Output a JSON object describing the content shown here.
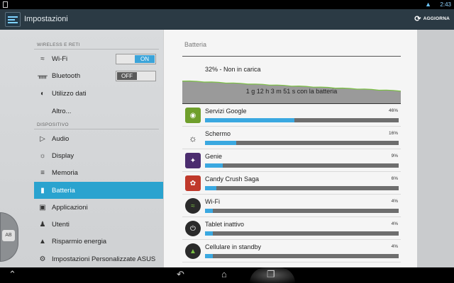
{
  "status_bar": {
    "time": "2:43",
    "wifi_icon": "wifi-icon"
  },
  "action_bar": {
    "title": "Impostazioni",
    "refresh_label": "AGGIORNA"
  },
  "sidebar": {
    "sections": [
      {
        "header": "WIRELESS E RETI"
      },
      {
        "header": "DISPOSITIVO"
      }
    ],
    "items": [
      {
        "label": "Wi-Fi",
        "icon": "wifi-icon",
        "toggle": "ON"
      },
      {
        "label": "Bluetooth",
        "icon": "bluetooth-icon",
        "toggle": "OFF"
      },
      {
        "label": "Utilizzo dati",
        "icon": "data-usage-icon"
      },
      {
        "label": "Altro..."
      },
      {
        "label": "Audio",
        "icon": "speaker-icon"
      },
      {
        "label": "Display",
        "icon": "brightness-icon"
      },
      {
        "label": "Memoria",
        "icon": "storage-icon"
      },
      {
        "label": "Batteria",
        "icon": "battery-icon",
        "active": true
      },
      {
        "label": "Applicazioni",
        "icon": "apps-icon"
      },
      {
        "label": "Utenti",
        "icon": "user-icon"
      },
      {
        "label": "Risparmio energia",
        "icon": "power-saving-icon"
      },
      {
        "label": "Impostazioni Personalizzate ASUS",
        "icon": "gear-icon"
      }
    ],
    "handle_label": "AB"
  },
  "battery": {
    "title": "Batteria",
    "status": "32% - Non in carica",
    "graph_caption": "1 g 12 h 3 m 51 s con la batteria",
    "level_start_percent": 100,
    "level_end_percent": 32,
    "apps": [
      {
        "name": "Servizi Google",
        "percent": "46%",
        "value": 46,
        "icon": "android-icon",
        "icon_color": "#6f9f2c"
      },
      {
        "name": "Schermo",
        "percent": "16%",
        "value": 16,
        "icon": "brightness-icon",
        "icon_color": "#444444"
      },
      {
        "name": "Genie",
        "percent": "9%",
        "value": 9,
        "icon": "genie-icon",
        "icon_color": "#4b2c6e"
      },
      {
        "name": "Candy Crush Saga",
        "percent": "6%",
        "value": 6,
        "icon": "candy-icon",
        "icon_color": "#c0392b"
      },
      {
        "name": "Wi-Fi",
        "percent": "4%",
        "value": 4,
        "icon": "wifi-icon",
        "icon_color": "#2a2a2a"
      },
      {
        "name": "Tablet inattivo",
        "percent": "4%",
        "value": 4,
        "icon": "power-icon",
        "icon_color": "#2a2a2a"
      },
      {
        "name": "Cellulare in standby",
        "percent": "4%",
        "value": 4,
        "icon": "signal-icon",
        "icon_color": "#2a2a2a"
      }
    ]
  },
  "colors": {
    "accent": "#2aa3cf",
    "usage_bar": "#3aa8e0",
    "graph_line": "#7bc043"
  }
}
